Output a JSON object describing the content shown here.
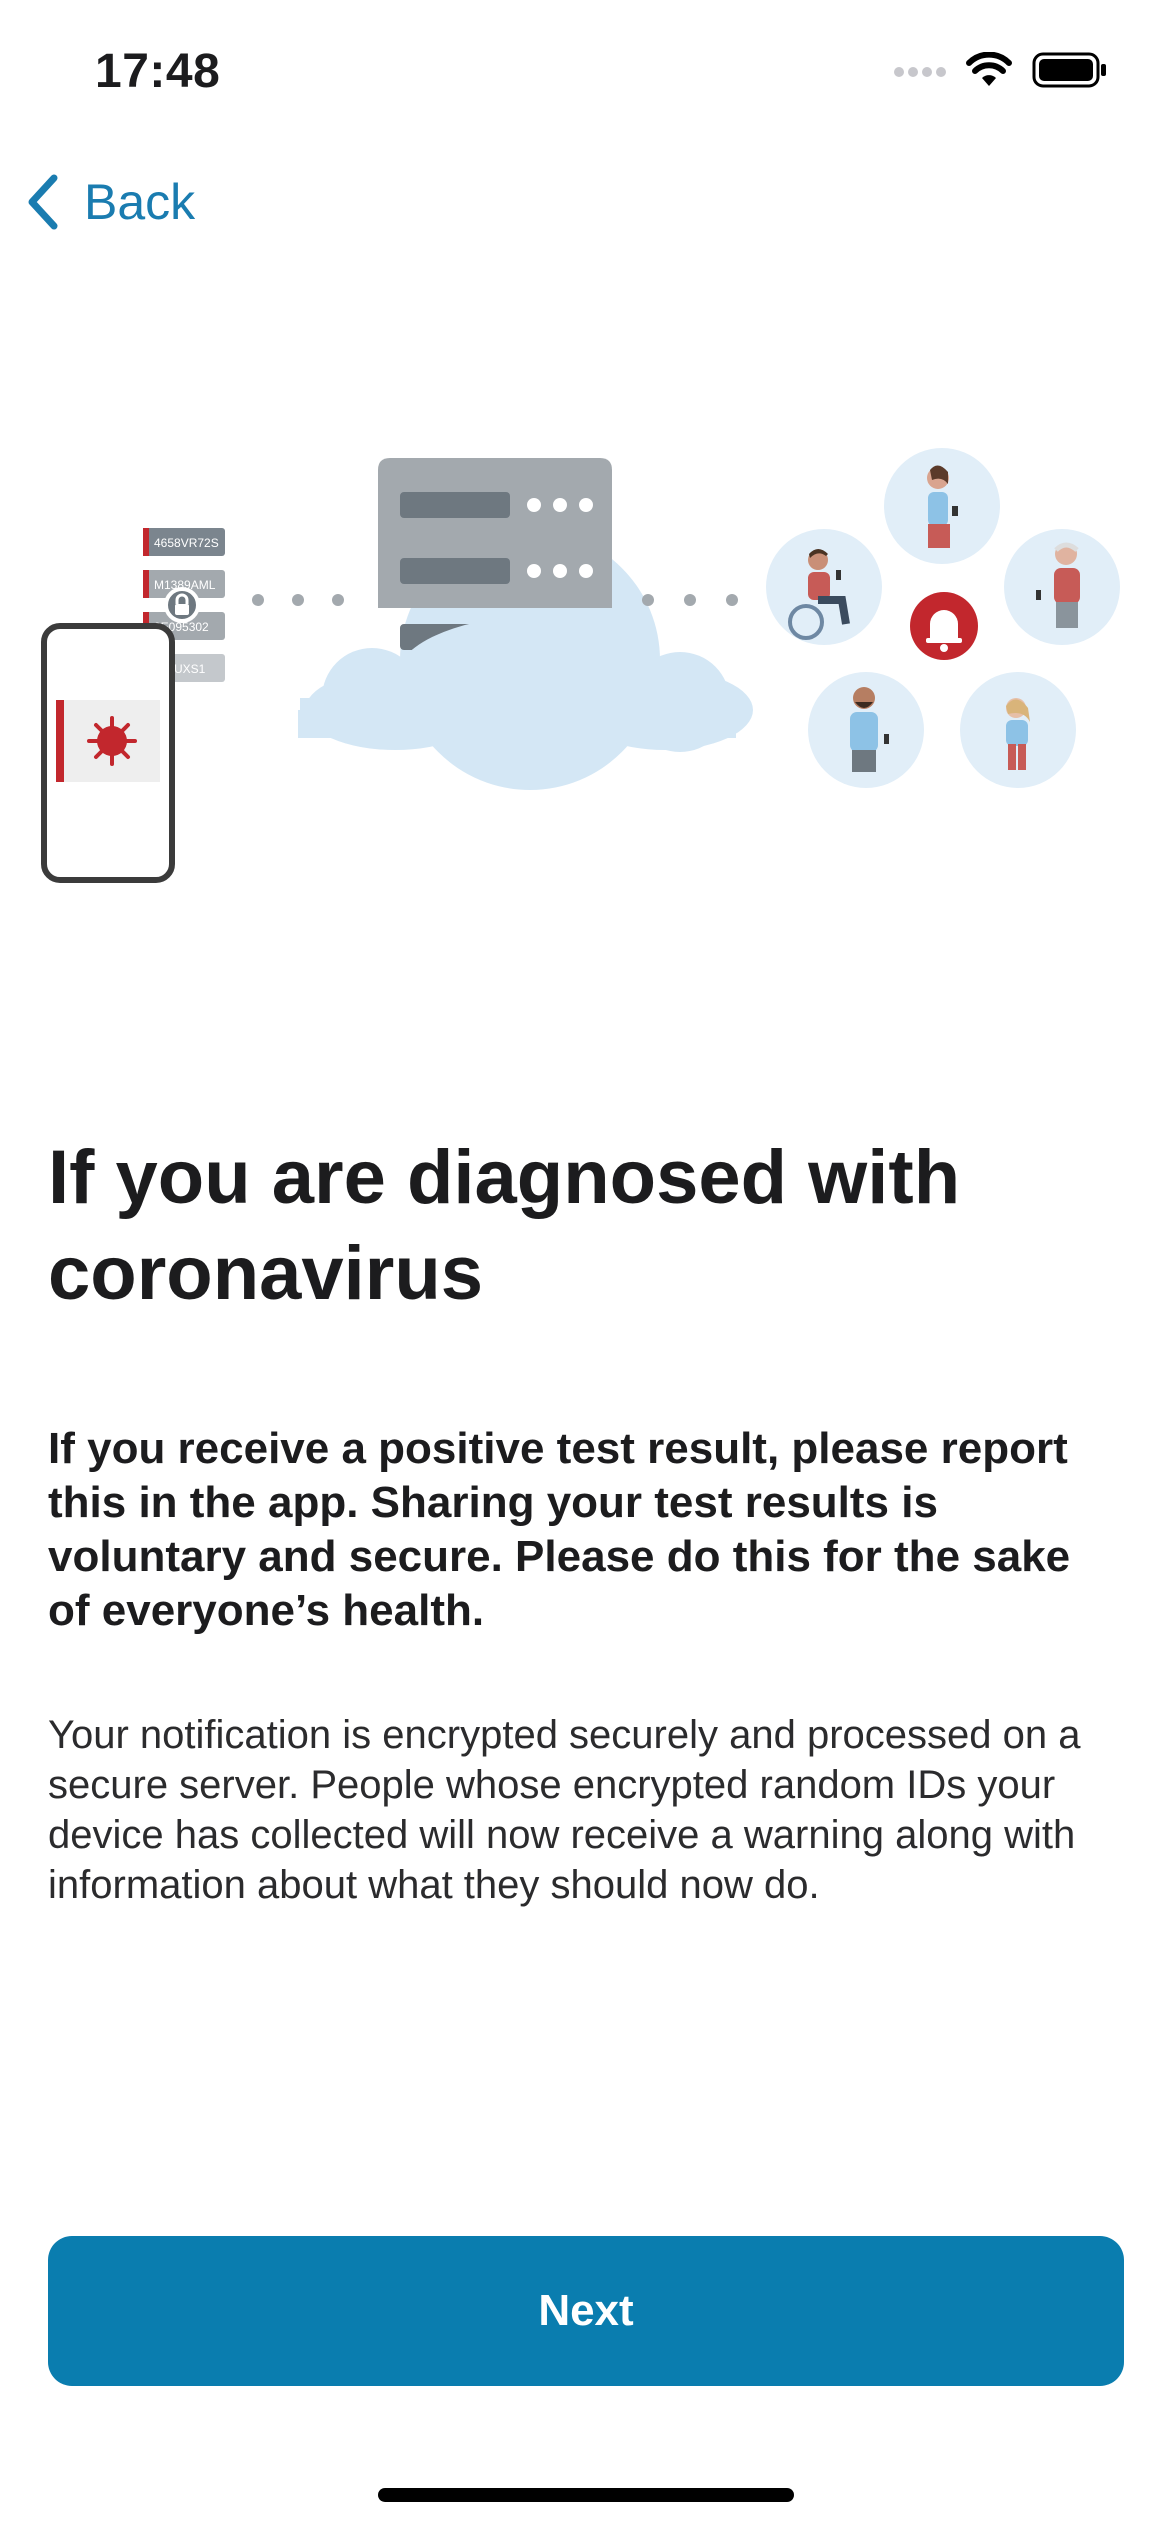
{
  "status_bar": {
    "time": "17:48",
    "icons": [
      "signal-icon",
      "wifi-icon",
      "battery-icon"
    ]
  },
  "nav": {
    "back_label": "Back",
    "accent_color": "#1a7cb0"
  },
  "illustration": {
    "id_tags": [
      "4658VR72S",
      "M1389AML",
      "9E095302",
      "4GUXS1"
    ]
  },
  "content": {
    "title": "If you are diagnosed with coronavirus",
    "lead": "If you receive a positive test result, please report this in the app. Sharing your test results is voluntary and secure. Please do this for the sake of everyone’s health.",
    "body": "Your notification is encrypted securely and processed on a secure server. People whose encrypted random IDs your device has collected will now receive a warning along with information about what they should now do."
  },
  "actions": {
    "next_label": "Next",
    "button_color": "#0a7daf"
  }
}
